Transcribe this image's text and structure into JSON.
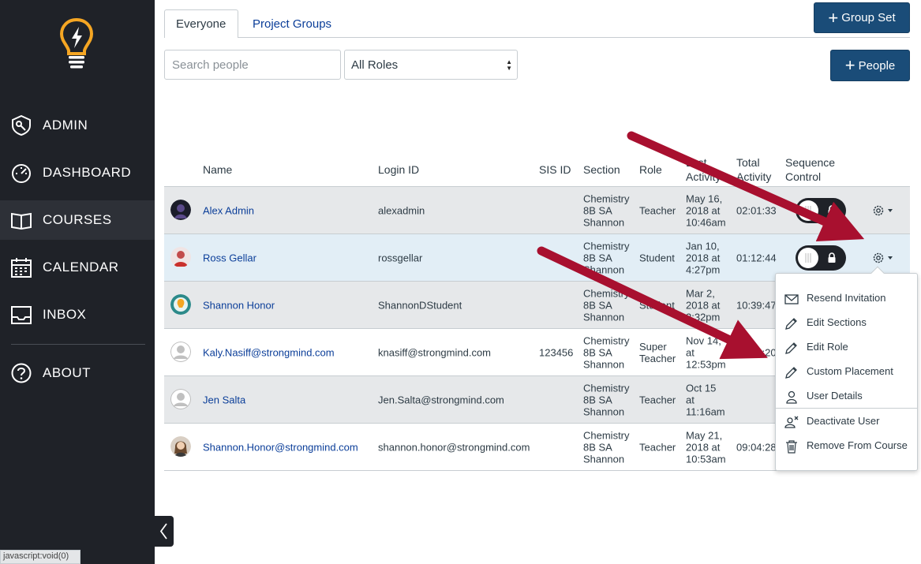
{
  "sidebar": {
    "items": [
      {
        "label": "ADMIN",
        "icon": "admin-shield-icon"
      },
      {
        "label": "DASHBOARD",
        "icon": "dashboard-gauge-icon"
      },
      {
        "label": "COURSES",
        "icon": "book-icon"
      },
      {
        "label": "CALENDAR",
        "icon": "calendar-icon"
      },
      {
        "label": "INBOX",
        "icon": "inbox-icon"
      },
      {
        "label": "ABOUT",
        "icon": "question-icon"
      }
    ],
    "active": "COURSES"
  },
  "status_bar": "javascript:void(0)",
  "tabs": [
    {
      "label": "Everyone",
      "active": true
    },
    {
      "label": "Project Groups",
      "active": false
    }
  ],
  "buttons": {
    "group_set": "Group Set",
    "people": "People"
  },
  "search": {
    "placeholder": "Search people"
  },
  "roles_select": {
    "value": "All Roles"
  },
  "table": {
    "headers": {
      "name": "Name",
      "login_id": "Login ID",
      "sis_id": "SIS ID",
      "section": "Section",
      "role": "Role",
      "last_activity_1": "Last",
      "last_activity_2": "Activity",
      "total_activity_1": "Total",
      "total_activity_2": "Activity",
      "sequence_1": "Sequence",
      "sequence_2": "Control"
    },
    "rows": [
      {
        "name": "Alex Admin",
        "login": "alexadmin",
        "sis": "",
        "section": [
          "Chemistry",
          "8B SA",
          "Shannon"
        ],
        "role": "Teacher",
        "last": [
          "May 16,",
          "2018 at",
          "10:46am"
        ],
        "total": "02:01:33"
      },
      {
        "name": "Ross Gellar",
        "login": "rossgellar",
        "sis": "",
        "section": [
          "Chemistry",
          "8B SA",
          "Shannon"
        ],
        "role": "Student",
        "last": [
          "Jan 10,",
          "2018 at",
          "4:27pm"
        ],
        "total": "01:12:44"
      },
      {
        "name": "Shannon Honor",
        "login": "ShannonDStudent",
        "sis": "",
        "section": [
          "Chemistry",
          "8B SA",
          "Shannon"
        ],
        "role": "Student",
        "last": [
          "Mar 2,",
          "2018 at",
          "2:32pm"
        ],
        "total": "10:39:47"
      },
      {
        "name": "Kaly.Nasiff@strongmind.com",
        "login": "knasiff@strongmind.com",
        "sis": "123456",
        "section": [
          "Chemistry",
          "8B SA",
          "Shannon"
        ],
        "role": "Super\nTeacher",
        "role_lines": [
          "Super",
          "Teacher"
        ],
        "last": [
          "Nov 14,",
          "at",
          "12:53pm"
        ],
        "total": "00:00:20"
      },
      {
        "name": "Jen Salta",
        "login": "Jen.Salta@strongmind.com",
        "sis": "",
        "section": [
          "Chemistry",
          "8B SA",
          "Shannon"
        ],
        "role": "Teacher",
        "last": [
          "Oct 15",
          "at",
          "11:16am"
        ],
        "total": ""
      },
      {
        "name": "Shannon.Honor@strongmind.com",
        "login": "shannon.honor@strongmind.com",
        "sis": "",
        "section": [
          "Chemistry",
          "8B SA",
          "Shannon"
        ],
        "role": "Teacher",
        "last": [
          "May 21,",
          "2018 at",
          "10:53am"
        ],
        "total": "09:04:28"
      }
    ]
  },
  "menu": {
    "items": [
      {
        "label": "Resend Invitation",
        "icon": "envelope-icon"
      },
      {
        "label": "Edit Sections",
        "icon": "pencil-icon"
      },
      {
        "label": "Edit Role",
        "icon": "pencil-icon"
      },
      {
        "label": "Custom Placement",
        "icon": "pencil-icon"
      },
      {
        "label": "User Details",
        "icon": "user-icon"
      },
      {
        "label": "Deactivate User",
        "icon": "user-remove-icon"
      },
      {
        "label": "Remove From Course",
        "icon": "trash-icon"
      }
    ]
  },
  "colors": {
    "sidebar": "#1f2228",
    "primary": "#1a4c78",
    "link": "#0b3e99",
    "annotation_arrow": "#a8102f"
  }
}
